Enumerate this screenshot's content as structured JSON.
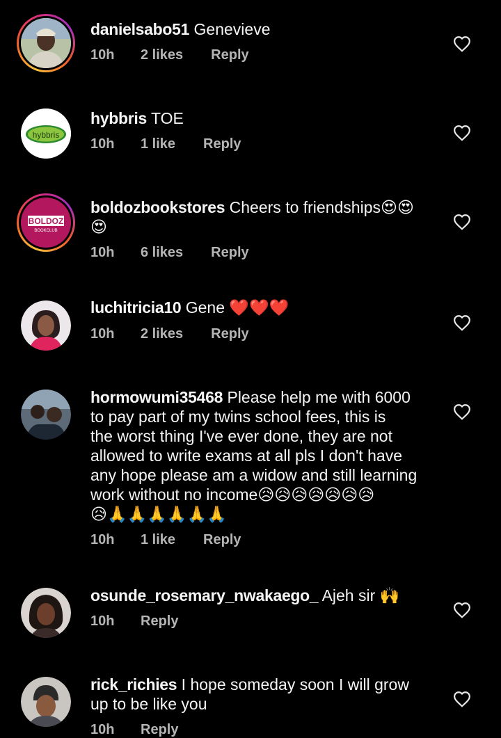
{
  "colors": {
    "background": "#000000",
    "text": "#f5f5f5",
    "meta": "#b5b5b5",
    "story_ring": "#d62c7b"
  },
  "comments": [
    {
      "username": "danielsabo51",
      "text": "Genevieve",
      "time": "10h",
      "likes": "2 likes",
      "reply": "Reply",
      "avatar_icon": "user-photo-icon"
    },
    {
      "username": "hybbris",
      "text": "TOE",
      "time": "10h",
      "likes": "1 like",
      "reply": "Reply",
      "avatar_logo": "hybbris"
    },
    {
      "username": "boldozbookstores",
      "text": "Cheers to friendships😍😍",
      "text2": "😍",
      "time": "10h",
      "likes": "6 likes",
      "reply": "Reply",
      "avatar_logo": "BOLDOZ",
      "avatar_logo_sub": "BOOKCLUB"
    },
    {
      "username": "luchitricia10",
      "text": "Gene ❤️❤️❤️",
      "time": "10h",
      "likes": "2 likes",
      "reply": "Reply"
    },
    {
      "username": "hormowumi35468",
      "text_lines": [
        "Please help me with 6000",
        "to pay part of my twins school fees, this is",
        "the worst thing I've ever done, they are not",
        "allowed to write exams at all pls I don't have",
        "any hope please am a widow and still learning",
        "work without no income😥😥😥😥😥😥😥",
        "😥🙏🙏🙏🙏🙏🙏"
      ],
      "time": "10h",
      "likes": "1 like",
      "reply": "Reply"
    },
    {
      "username": "osunde_rosemary_nwakaego_",
      "text": "Ajeh sir 🙌",
      "time": "10h",
      "reply": "Reply"
    },
    {
      "username": "rick_richies",
      "text": "I hope someday soon I will grow",
      "text2": "up to be like you",
      "time": "10h",
      "reply": "Reply"
    }
  ]
}
